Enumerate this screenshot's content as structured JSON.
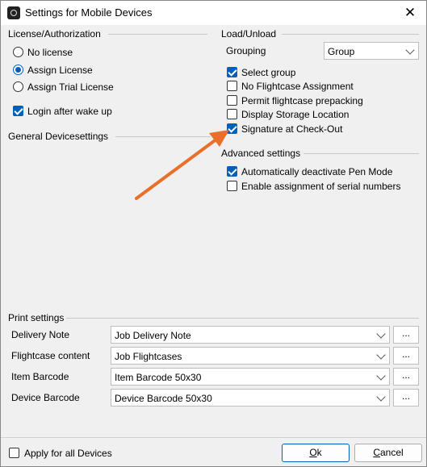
{
  "window": {
    "title": "Settings for Mobile Devices",
    "close_glyph": "✕"
  },
  "license": {
    "heading": "License/Authorization",
    "options": [
      {
        "label": "No license",
        "checked": false
      },
      {
        "label": "Assign License",
        "checked": true
      },
      {
        "label": "Assign Trial License",
        "checked": false
      }
    ],
    "login_after_wake": {
      "label": "Login after wake up",
      "checked": true
    }
  },
  "general": {
    "heading": "General Devicesettings"
  },
  "load_unload": {
    "heading": "Load/Unload",
    "grouping_label": "Grouping",
    "grouping_value": "Group",
    "checks": [
      {
        "label": "Select group",
        "checked": true
      },
      {
        "label": "No Flightcase Assignment",
        "checked": false
      },
      {
        "label": "Permit flightcase prepacking",
        "checked": false
      },
      {
        "label": "Display Storage Location",
        "checked": false
      },
      {
        "label": "Signature at Check-Out",
        "checked": true
      }
    ]
  },
  "advanced": {
    "heading": "Advanced settings",
    "checks": [
      {
        "label": "Automatically deactivate Pen Mode",
        "checked": true
      },
      {
        "label": "Enable assignment of serial numbers",
        "checked": false
      }
    ]
  },
  "print": {
    "heading": "Print settings",
    "rows": [
      {
        "label": "Delivery Note",
        "value": "Job Delivery Note",
        "button": "..."
      },
      {
        "label": "Flightcase content",
        "value": "Job Flightcases",
        "button": "..."
      },
      {
        "label": "Item Barcode",
        "value": "Item Barcode 50x30",
        "button": "..."
      },
      {
        "label": "Device Barcode",
        "value": "Device Barcode 50x30",
        "button": "..."
      }
    ]
  },
  "footer": {
    "apply_all": {
      "label": "Apply for all Devices",
      "checked": false
    },
    "ok": {
      "mnemonic": "O",
      "rest": "k"
    },
    "cancel": {
      "mnemonic": "C",
      "rest": "ancel"
    }
  },
  "annotation": {
    "arrow_color": "#e8702a"
  },
  "colors": {
    "accent": "#005fb8"
  }
}
